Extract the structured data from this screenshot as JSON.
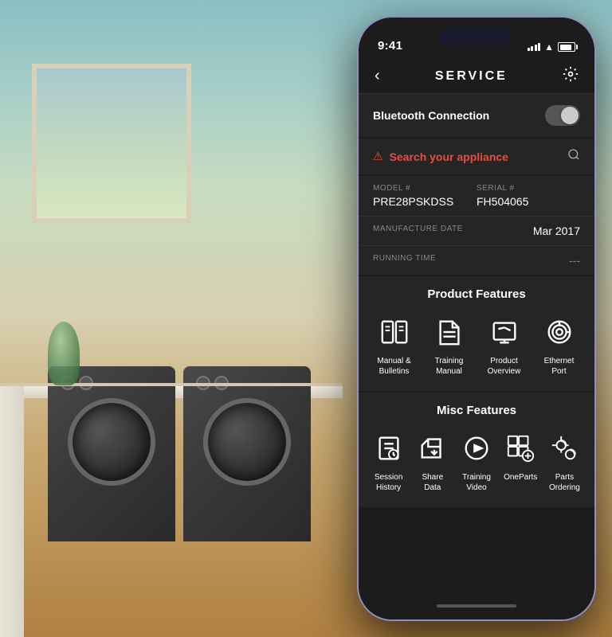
{
  "background": {
    "description": "Laundry room with washer and dryer"
  },
  "phone": {
    "status_bar": {
      "time": "9:41",
      "signal": "full",
      "wifi": "on",
      "battery": "full"
    },
    "nav": {
      "title": "SERVICE",
      "back_label": "‹",
      "settings_label": "⚙"
    },
    "bluetooth": {
      "label": "Bluetooth Connection",
      "enabled": false
    },
    "search_appliance": {
      "label": "Search your appliance",
      "has_warning": true
    },
    "appliance_info": {
      "model_label": "Model #",
      "model_value": "PRE28PSKDSS",
      "serial_label": "Serial #",
      "serial_value": "FH504065",
      "manufacture_date_label": "Manufacture Date",
      "manufacture_date_value": "Mar 2017",
      "running_time_label": "Running Time",
      "running_time_value": "---"
    },
    "product_features": {
      "title": "Product Features",
      "items": [
        {
          "id": "manual",
          "label": "Manual &\nBulletins",
          "icon": "book-open"
        },
        {
          "id": "training-manual",
          "label": "Training\nManual",
          "icon": "book"
        },
        {
          "id": "product-overview",
          "label": "Product\nOverview",
          "icon": "document"
        },
        {
          "id": "ethernet-port",
          "label": "Ethernet\nPort",
          "icon": "wifi-circle"
        }
      ]
    },
    "misc_features": {
      "title": "Misc Features",
      "items": [
        {
          "id": "session-history",
          "label": "Session\nHistory",
          "icon": "clipboard-clock"
        },
        {
          "id": "share-data",
          "label": "Share\nData",
          "icon": "folder-share"
        },
        {
          "id": "training-video",
          "label": "Training\nVideo",
          "icon": "play-circle"
        },
        {
          "id": "one-parts",
          "label": "OneParts",
          "icon": "grid-gear"
        },
        {
          "id": "parts-ordering",
          "label": "Parts\nOrdering",
          "icon": "gear-wrench"
        }
      ]
    }
  }
}
